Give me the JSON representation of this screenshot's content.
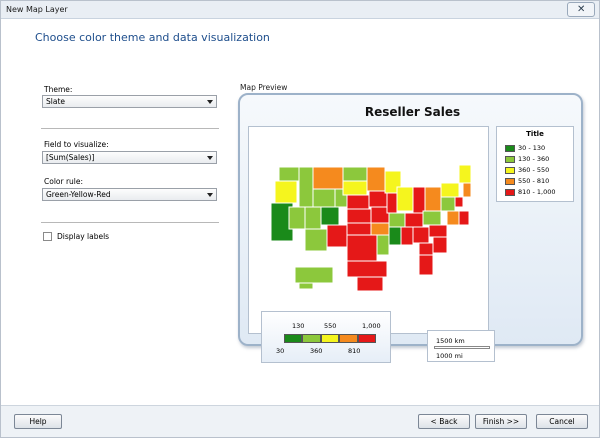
{
  "window": {
    "title": "New Map Layer",
    "close_label": "✕"
  },
  "heading": "Choose color theme and data visualization",
  "form": {
    "theme_label": "Theme:",
    "theme_value": "Slate",
    "field_label": "Field to visualize:",
    "field_value": "[Sum(Sales)]",
    "color_rule_label": "Color rule:",
    "color_rule_value": "Green-Yellow-Red",
    "display_labels_label": "Display labels",
    "display_labels_checked": false
  },
  "preview": {
    "label": "Map Preview",
    "map_title": "Reseller Sales",
    "legend": {
      "title": "Title",
      "items": [
        {
          "label": "30 - 130",
          "color": "#1a8a1a"
        },
        {
          "label": "130 - 360",
          "color": "#8cc83c"
        },
        {
          "label": "360 - 550",
          "color": "#f5f51e"
        },
        {
          "label": "550 - 810",
          "color": "#f58a1e"
        },
        {
          "label": "810 - 1,000",
          "color": "#e51818"
        }
      ]
    },
    "color_scale": {
      "top_labels": [
        "130",
        "550",
        "1,000"
      ],
      "bottom_labels": [
        "30",
        "360",
        "810"
      ],
      "colors": [
        "#1a8a1a",
        "#8cc83c",
        "#f5f51e",
        "#f58a1e",
        "#e51818"
      ]
    },
    "distance_scale": {
      "km": "1500 km",
      "mi": "1000 mi"
    }
  },
  "footer": {
    "help_label": "Help",
    "back_label": "< Back",
    "finish_label": "Finish >>",
    "cancel_label": "Cancel"
  }
}
